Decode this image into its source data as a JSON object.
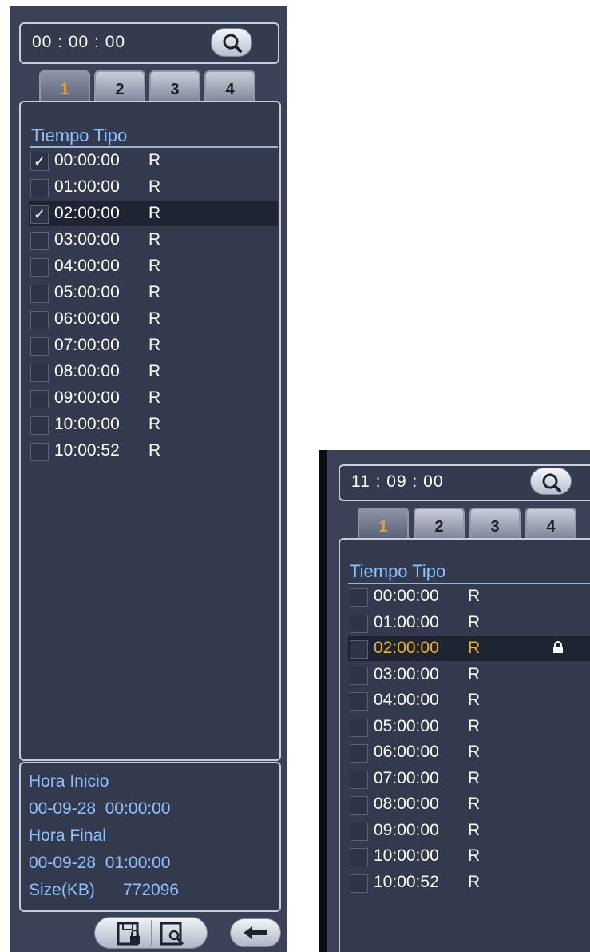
{
  "left_panel": {
    "time": "00 : 00 : 00",
    "tabs": [
      "1",
      "2",
      "3",
      "4"
    ],
    "active_tab": "1",
    "header": "Tiempo Tipo",
    "rows": [
      {
        "time": "00:00:00",
        "type": "R",
        "checked": true
      },
      {
        "time": "01:00:00",
        "type": "R",
        "checked": false
      },
      {
        "time": "02:00:00",
        "type": "R",
        "checked": true
      },
      {
        "time": "03:00:00",
        "type": "R",
        "checked": false
      },
      {
        "time": "04:00:00",
        "type": "R",
        "checked": false
      },
      {
        "time": "05:00:00",
        "type": "R",
        "checked": false
      },
      {
        "time": "06:00:00",
        "type": "R",
        "checked": false
      },
      {
        "time": "07:00:00",
        "type": "R",
        "checked": false
      },
      {
        "time": "08:00:00",
        "type": "R",
        "checked": false
      },
      {
        "time": "09:00:00",
        "type": "R",
        "checked": false
      },
      {
        "time": "10:00:00",
        "type": "R",
        "checked": false
      },
      {
        "time": "10:00:52",
        "type": "R",
        "checked": false
      }
    ],
    "selected_row": 2,
    "info": {
      "start_label": "Hora Inicio",
      "start_value": "00-09-28  00:00:00",
      "end_label": "Hora Final",
      "end_value": "00-09-28  01:00:00",
      "size_label": "Size(KB)",
      "size_value": "772096"
    }
  },
  "right_panel": {
    "time": "11 : 09 : 00",
    "tabs": [
      "1",
      "2",
      "3",
      "4"
    ],
    "active_tab": "1",
    "header": "Tiempo Tipo",
    "rows": [
      {
        "time": "00:00:00",
        "type": "R",
        "checked": false
      },
      {
        "time": "01:00:00",
        "type": "R",
        "checked": false
      },
      {
        "time": "02:00:00",
        "type": "R",
        "checked": false,
        "locked": true
      },
      {
        "time": "03:00:00",
        "type": "R",
        "checked": false
      },
      {
        "time": "04:00:00",
        "type": "R",
        "checked": false
      },
      {
        "time": "05:00:00",
        "type": "R",
        "checked": false
      },
      {
        "time": "06:00:00",
        "type": "R",
        "checked": false
      },
      {
        "time": "07:00:00",
        "type": "R",
        "checked": false
      },
      {
        "time": "08:00:00",
        "type": "R",
        "checked": false
      },
      {
        "time": "09:00:00",
        "type": "R",
        "checked": false
      },
      {
        "time": "10:00:00",
        "type": "R",
        "checked": false
      },
      {
        "time": "10:00:52",
        "type": "R",
        "checked": false
      }
    ],
    "selected_row": 2
  },
  "icons": {
    "search": "search-icon",
    "lock": "lock-icon",
    "lock_file": "lock-file-icon",
    "file_search": "file-search-icon",
    "back": "back-arrow-icon"
  },
  "colors": {
    "panel_bg": "#3b4258",
    "header_text": "#8cc1ff",
    "highlight_text": "#f0b21f",
    "active_tab_text": "#e8a027"
  }
}
